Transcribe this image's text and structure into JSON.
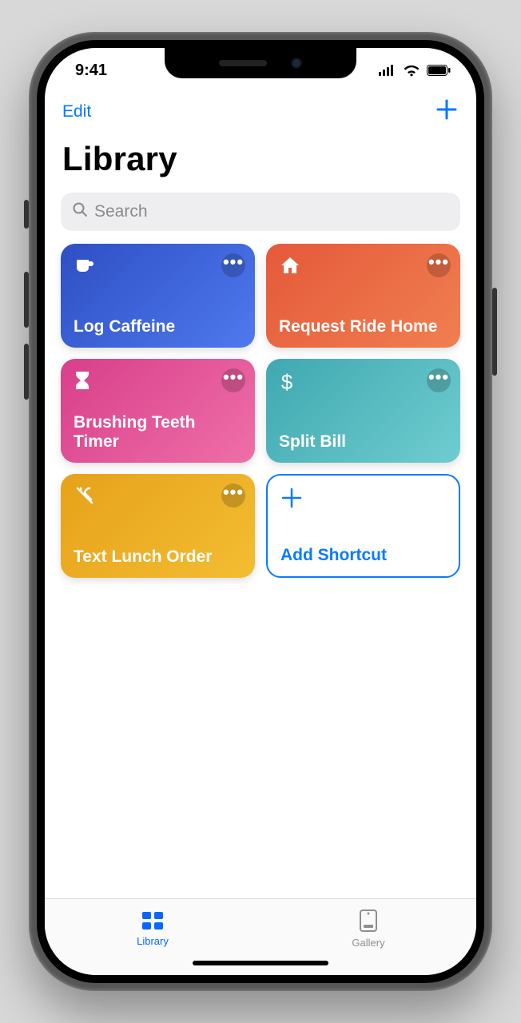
{
  "status": {
    "time": "9:41"
  },
  "nav": {
    "edit": "Edit"
  },
  "title": "Library",
  "search": {
    "placeholder": "Search"
  },
  "shortcuts": [
    {
      "label": "Log Caffeine",
      "icon": "cup",
      "color": "blue"
    },
    {
      "label": "Request Ride Home",
      "icon": "home",
      "color": "orange"
    },
    {
      "label": "Brushing Teeth Timer",
      "icon": "hourglass",
      "color": "pink"
    },
    {
      "label": "Split Bill",
      "icon": "dollar",
      "color": "teal"
    },
    {
      "label": "Text Lunch Order",
      "icon": "utensils",
      "color": "yellow"
    }
  ],
  "add_card": {
    "label": "Add Shortcut"
  },
  "tabs": {
    "library": "Library",
    "gallery": "Gallery"
  }
}
